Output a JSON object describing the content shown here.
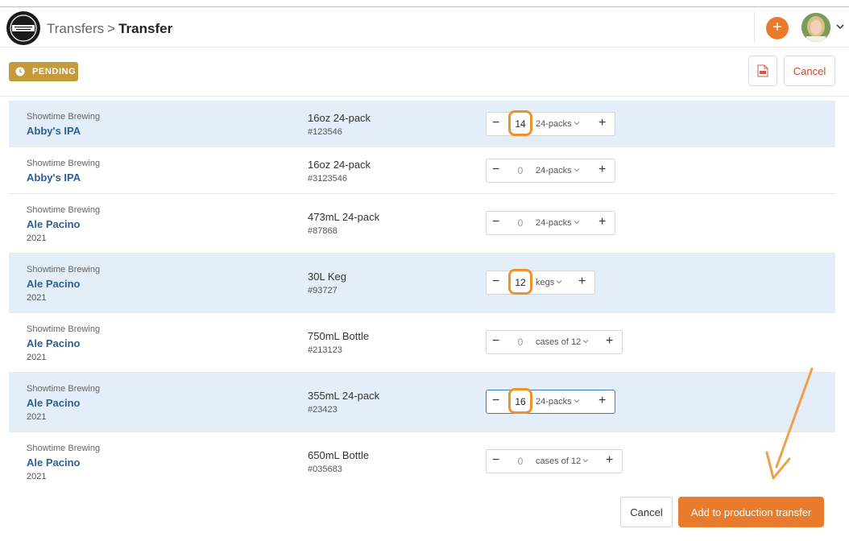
{
  "header": {
    "breadcrumb_parent": "Transfers",
    "breadcrumb_separator": ">",
    "breadcrumb_current": "Transfer",
    "add_label": "+"
  },
  "status": {
    "label": "PENDING",
    "color": "#c49a3a"
  },
  "toolbar": {
    "pdf_icon": "pdf-icon",
    "cancel_label": "Cancel"
  },
  "rows": [
    {
      "brewery": "Showtime Brewing",
      "product": "Abby's IPA",
      "year": "",
      "package": "16oz 24-pack",
      "sku": "#123546",
      "qty": "14",
      "unit": "24-packs",
      "selected": true
    },
    {
      "brewery": "Showtime Brewing",
      "product": "Abby's IPA",
      "year": "",
      "package": "16oz 24-pack",
      "sku": "#3123546",
      "qty": "0",
      "unit": "24-packs",
      "selected": false
    },
    {
      "brewery": "Showtime Brewing",
      "product": "Ale Pacino",
      "year": "2021",
      "package": "473mL 24-pack",
      "sku": "#87868",
      "qty": "0",
      "unit": "24-packs",
      "selected": false
    },
    {
      "brewery": "Showtime Brewing",
      "product": "Ale Pacino",
      "year": "2021",
      "package": "30L Keg",
      "sku": "#93727",
      "qty": "12",
      "unit": "kegs",
      "selected": true
    },
    {
      "brewery": "Showtime Brewing",
      "product": "Ale Pacino",
      "year": "2021",
      "package": "750mL Bottle",
      "sku": "#213123",
      "qty": "0",
      "unit": "cases of 12",
      "selected": false
    },
    {
      "brewery": "Showtime Brewing",
      "product": "Ale Pacino",
      "year": "2021",
      "package": "355mL 24-pack",
      "sku": "#23423",
      "qty": "16",
      "unit": "24-packs",
      "selected": true
    },
    {
      "brewery": "Showtime Brewing",
      "product": "Ale Pacino",
      "year": "2021",
      "package": "650mL Bottle",
      "sku": "#035683",
      "qty": "0",
      "unit": "cases of 12",
      "selected": false
    }
  ],
  "footer": {
    "cancel_label": "Cancel",
    "submit_label": "Add to production transfer"
  },
  "colors": {
    "accent": "#e87b2c",
    "link": "#2f5f8f",
    "selected_row": "#e3eef8",
    "highlight": "#f0912a",
    "danger": "#d0452f"
  }
}
